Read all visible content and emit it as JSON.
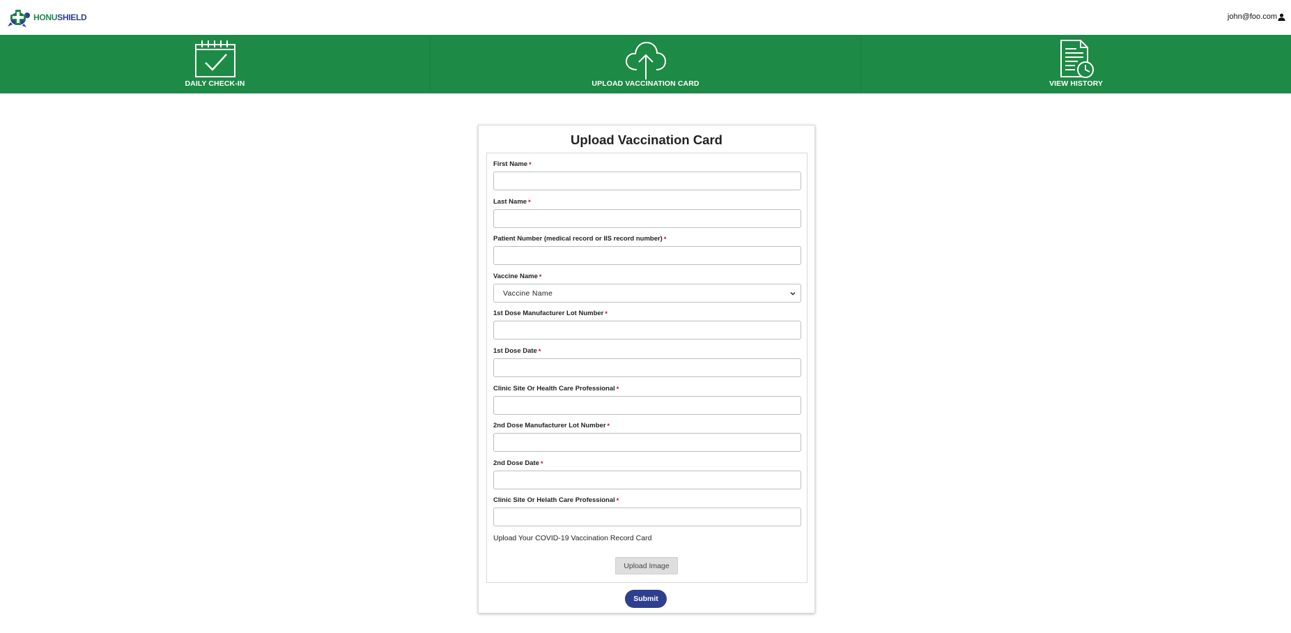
{
  "brand": {
    "name_part1": "HONU",
    "name_part2": "SHIELD"
  },
  "user": {
    "email": "john@foo.com",
    "icon": "user-icon"
  },
  "nav": {
    "items": [
      {
        "label": "DAILY CHECK-IN",
        "icon": "calendar-check-icon"
      },
      {
        "label": "UPLOAD VACCINATION CARD",
        "icon": "cloud-upload-icon"
      },
      {
        "label": "VIEW HISTORY",
        "icon": "document-clock-icon"
      }
    ]
  },
  "form": {
    "title": "Upload Vaccination Card",
    "required_mark": "*",
    "fields": [
      {
        "label": "First Name",
        "value": ""
      },
      {
        "label": "Last Name",
        "value": ""
      },
      {
        "label": "Patient Number (medical record or IIS record number)",
        "value": ""
      },
      {
        "label": "Vaccine Name",
        "selected": "Vaccine Name"
      },
      {
        "label": "1st Dose Manufacturer Lot Number",
        "value": ""
      },
      {
        "label": "1st Dose Date",
        "value": ""
      },
      {
        "label": "Clinic Site Or Health Care Professional",
        "value": ""
      },
      {
        "label": "2nd Dose Manufacturer Lot Number",
        "value": ""
      },
      {
        "label": "2nd Dose Date",
        "value": ""
      },
      {
        "label": "Clinic Site Or Helath Care Professional",
        "value": ""
      }
    ],
    "upload_prompt": "Upload Your COVID-19 Vaccination Record Card",
    "upload_button": "Upload Image",
    "submit_button": "Submit"
  },
  "colors": {
    "brand_green": "#1d8a45",
    "brand_navy": "#2f3f8f",
    "required_red": "#d0021b"
  }
}
